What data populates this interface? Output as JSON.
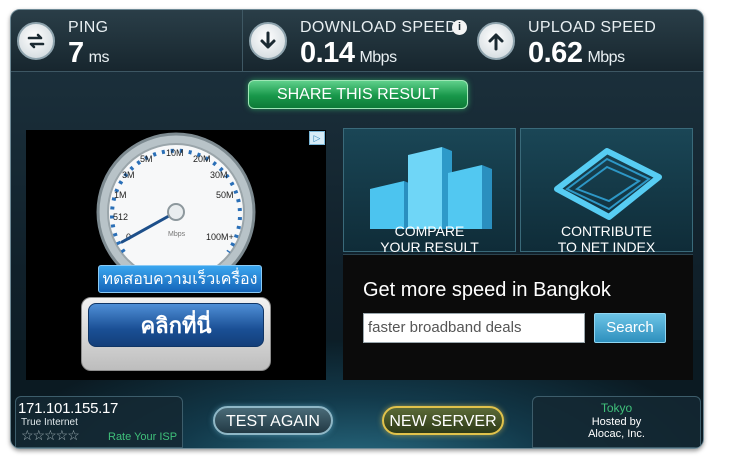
{
  "metrics": {
    "ping": {
      "label": "PING",
      "value": "7",
      "unit": "ms"
    },
    "download": {
      "label": "DOWNLOAD SPEED",
      "value": "0.14",
      "unit": "Mbps"
    },
    "upload": {
      "label": "UPLOAD SPEED",
      "value": "0.62",
      "unit": "Mbps"
    },
    "info_glyph": "i"
  },
  "share_label": "SHARE THIS RESULT",
  "ad": {
    "adchoices_glyph": "▷",
    "gauge_ticks": [
      "0",
      "512",
      "1M",
      "3M",
      "5M",
      "10M",
      "20M",
      "30M",
      "50M",
      "100M+"
    ],
    "gauge_unit": "Mbps",
    "caption": "ทดสอบความเร็วเครื่อง",
    "button": "คลิกที่นี่"
  },
  "tiles": {
    "compare": {
      "line1": "COMPARE",
      "line2": "YOUR RESULT"
    },
    "contribute": {
      "line1": "CONTRIBUTE",
      "line2": "TO NET INDEX"
    }
  },
  "offer": {
    "title": "Get more speed in Bangkok",
    "input_value": "faster broadband deals",
    "search_label": "Search"
  },
  "footer": {
    "ip": "171.101.155.17",
    "isp": "True Internet",
    "stars": "☆☆☆☆☆",
    "rate_label": "Rate Your ISP",
    "test_again": "TEST AGAIN",
    "new_server": "NEW SERVER",
    "city": "Tokyo",
    "hosted_by": "Hosted by",
    "host": "Alocac, Inc."
  },
  "icons": {
    "ping": "ping-arrows-icon",
    "download": "download-arrow-icon",
    "upload": "upload-arrow-icon"
  },
  "colors": {
    "share_green": "#18974a",
    "search_blue": "#2e8fbd",
    "rate_green": "#3fc07a",
    "new_server_border": "#e1c24b"
  }
}
